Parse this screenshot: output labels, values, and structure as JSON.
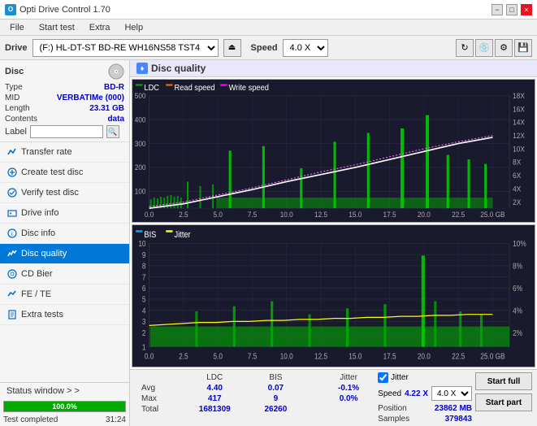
{
  "app": {
    "title": "Opti Drive Control 1.70",
    "icon": "O"
  },
  "titlebar": {
    "minimize": "−",
    "maximize": "□",
    "close": "×"
  },
  "menu": {
    "items": [
      "File",
      "Start test",
      "Extra",
      "Help"
    ]
  },
  "drivebar": {
    "label": "Drive",
    "drive_value": "(F:) HL-DT-ST BD-RE  WH16NS58 TST4",
    "speed_label": "Speed",
    "speed_value": "4.0 X"
  },
  "disc": {
    "title": "Disc",
    "type_label": "Type",
    "type_value": "BD-R",
    "mid_label": "MID",
    "mid_value": "VERBATIMe (000)",
    "length_label": "Length",
    "length_value": "23.31 GB",
    "contents_label": "Contents",
    "contents_value": "data",
    "label_label": "Label",
    "label_value": ""
  },
  "nav": {
    "items": [
      {
        "id": "transfer-rate",
        "label": "Transfer rate",
        "active": false
      },
      {
        "id": "create-test-disc",
        "label": "Create test disc",
        "active": false
      },
      {
        "id": "verify-test-disc",
        "label": "Verify test disc",
        "active": false
      },
      {
        "id": "drive-info",
        "label": "Drive info",
        "active": false
      },
      {
        "id": "disc-info",
        "label": "Disc info",
        "active": false
      },
      {
        "id": "disc-quality",
        "label": "Disc quality",
        "active": true
      },
      {
        "id": "cd-bier",
        "label": "CD Bier",
        "active": false
      },
      {
        "id": "fe-te",
        "label": "FE / TE",
        "active": false
      },
      {
        "id": "extra-tests",
        "label": "Extra tests",
        "active": false
      }
    ]
  },
  "status": {
    "window_label": "Status window > >",
    "progress": 100,
    "progress_text": "100.0%",
    "status_text": "Test completed",
    "time": "31:24"
  },
  "disc_quality": {
    "title": "Disc quality",
    "chart1": {
      "legend": [
        {
          "id": "ldc",
          "label": "LDC",
          "color": "#00aa00"
        },
        {
          "id": "read-speed",
          "label": "Read speed",
          "color": "#ff6600"
        },
        {
          "id": "write-speed",
          "label": "Write speed",
          "color": "#ff00ff"
        }
      ],
      "y_right_labels": [
        "18X",
        "16X",
        "14X",
        "12X",
        "10X",
        "8X",
        "6X",
        "4X",
        "2X"
      ],
      "x_labels": [
        "0.0",
        "2.5",
        "5.0",
        "7.5",
        "10.0",
        "12.5",
        "15.0",
        "17.5",
        "20.0",
        "22.5",
        "25.0 GB"
      ],
      "y_max": 500,
      "y_labels": [
        "500",
        "400",
        "300",
        "200",
        "100"
      ]
    },
    "chart2": {
      "legend": [
        {
          "id": "bis",
          "label": "BIS",
          "color": "#00aaff"
        },
        {
          "id": "jitter",
          "label": "Jitter",
          "color": "#ffff00"
        }
      ],
      "y_right_labels": [
        "10%",
        "8%",
        "6%",
        "4%",
        "2%"
      ],
      "x_labels": [
        "0.0",
        "2.5",
        "5.0",
        "7.5",
        "10.0",
        "12.5",
        "15.0",
        "17.5",
        "20.0",
        "22.5",
        "25.0 GB"
      ],
      "y_labels": [
        "10",
        "9",
        "8",
        "7",
        "6",
        "5",
        "4",
        "3",
        "2",
        "1"
      ]
    }
  },
  "stats": {
    "headers": [
      "",
      "LDC",
      "BIS",
      "",
      "Jitter",
      "Speed",
      ""
    ],
    "avg_label": "Avg",
    "avg_ldc": "4.40",
    "avg_bis": "0.07",
    "avg_jitter": "-0.1%",
    "max_label": "Max",
    "max_ldc": "417",
    "max_bis": "9",
    "max_jitter": "0.0%",
    "total_label": "Total",
    "total_ldc": "1681309",
    "total_bis": "26260",
    "jitter_checked": true,
    "jitter_label": "Jitter",
    "speed_label": "Speed",
    "speed_value": "4.22 X",
    "speed_select": "4.0 X",
    "position_label": "Position",
    "position_value": "23862 MB",
    "samples_label": "Samples",
    "samples_value": "379843",
    "btn_full": "Start full",
    "btn_part": "Start part"
  }
}
